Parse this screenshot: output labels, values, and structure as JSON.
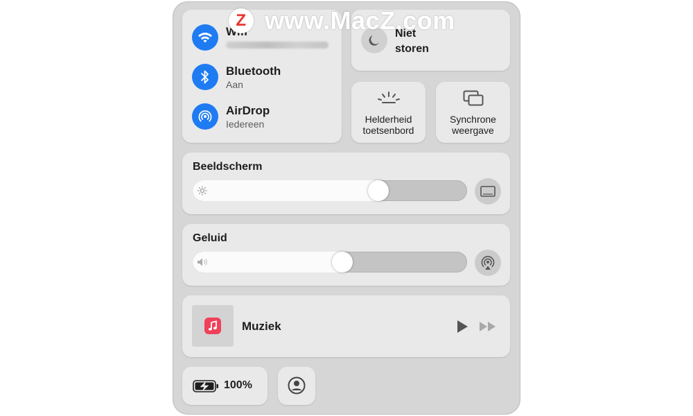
{
  "watermark": {
    "logo_letter": "Z",
    "text": "www.MacZ.com"
  },
  "connectivity": {
    "wifi": {
      "label": "Wifi",
      "status": ""
    },
    "bluetooth": {
      "label": "Bluetooth",
      "status": "Aan"
    },
    "airdrop": {
      "label": "AirDrop",
      "status": "Iedereen"
    }
  },
  "focus": {
    "label_line1": "Niet",
    "label_line2": "storen"
  },
  "keyboard_brightness": {
    "line1": "Helderheid",
    "line2": "toetsenbord"
  },
  "screen_mirroring": {
    "line1": "Synchrone",
    "line2": "weergave"
  },
  "display": {
    "title": "Beeldscherm",
    "level": 0.69
  },
  "sound": {
    "title": "Geluid",
    "level": 0.55
  },
  "now_playing": {
    "app": "Muziek"
  },
  "battery": {
    "percent": "100%"
  },
  "colors": {
    "accent": "#1f7bf2",
    "panel": "#d6d6d6",
    "tile": "#e9e9e9",
    "music": "#f0405a"
  }
}
